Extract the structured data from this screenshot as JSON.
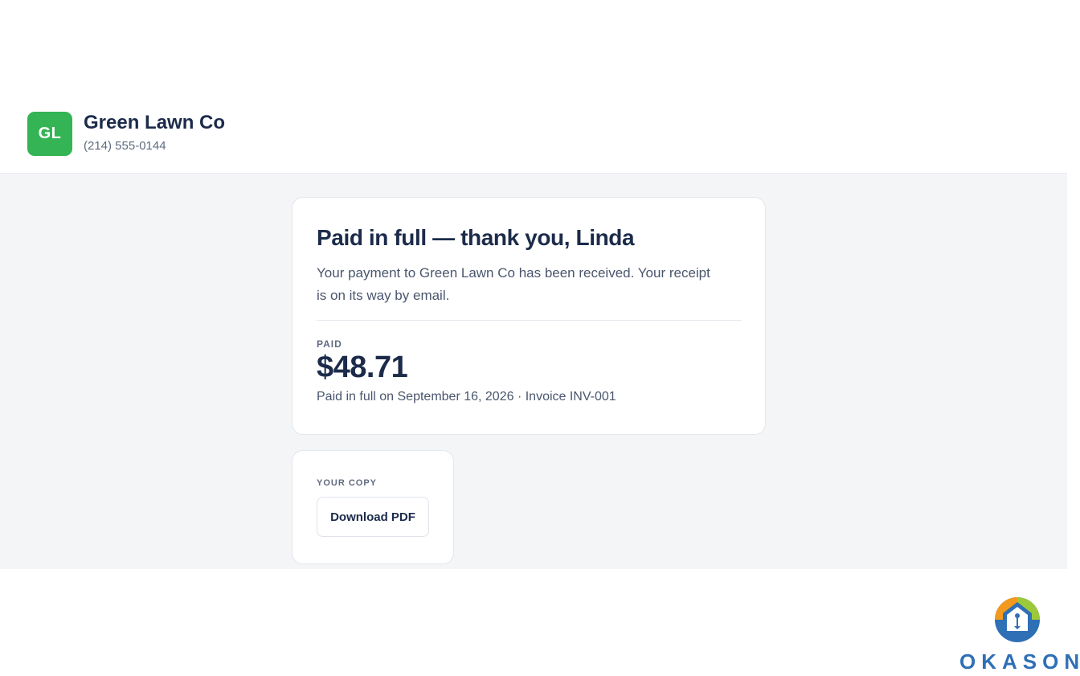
{
  "header": {
    "logo_initials": "GL",
    "business_name": "Green Lawn Co",
    "phone": "(214) 555-0144"
  },
  "payment": {
    "title": "Paid in full — thank you, Linda",
    "message": "Your payment to Green Lawn Co has been received. Your receipt is on its way by email.",
    "paid_label": "PAID",
    "amount": "$48.71",
    "detail": "Paid in full on September 16, 2026 · Invoice INV-001"
  },
  "copy": {
    "label": "YOUR COPY",
    "download_label": "Download PDF"
  },
  "watermark": {
    "brand_name": "OKASON"
  },
  "colors": {
    "logo_green": "#34b454",
    "text_dark": "#1c2b4a",
    "background_gray": "#f4f5f7",
    "brand_blue": "#2f6fb6",
    "brand_orange": "#f39a1e",
    "brand_lime": "#9cc93a"
  }
}
